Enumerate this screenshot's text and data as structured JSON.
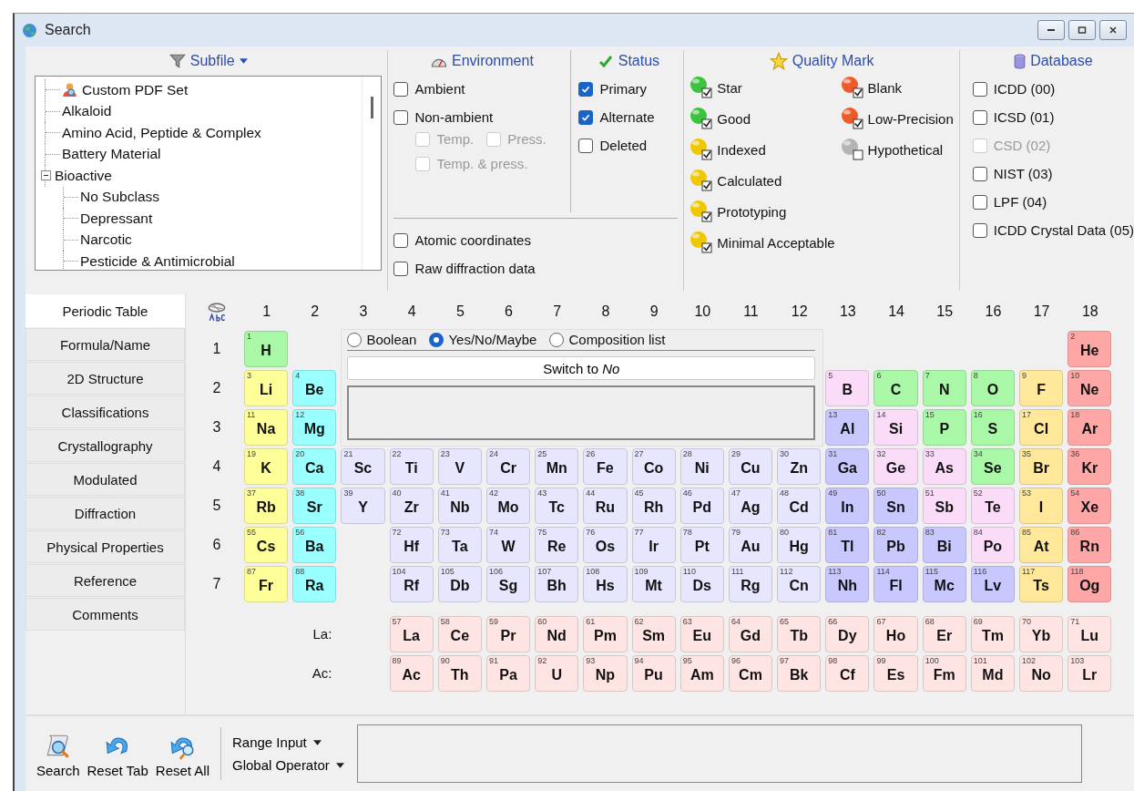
{
  "window": {
    "title": "Search"
  },
  "subfile": {
    "label": "Subfile",
    "tree": [
      {
        "label": "Custom PDF Set",
        "kind": "set"
      },
      {
        "label": "Alkaloid",
        "kind": "class"
      },
      {
        "label": "Amino Acid, Peptide & Complex",
        "kind": "class"
      },
      {
        "label": "Battery Material",
        "kind": "class"
      },
      {
        "label": "Bioactive",
        "kind": "class",
        "expanded": true,
        "children": [
          {
            "label": "No Subclass"
          },
          {
            "label": "Depressant"
          },
          {
            "label": "Narcotic"
          },
          {
            "label": "Pesticide & Antimicrobial"
          }
        ]
      }
    ]
  },
  "environment": {
    "label": "Environment",
    "options": [
      {
        "label": "Ambient",
        "checked": false,
        "disabled": false,
        "kind": "main"
      },
      {
        "label": "Non-ambient",
        "checked": false,
        "disabled": false,
        "kind": "main"
      },
      {
        "label": "Temp.",
        "checked": false,
        "disabled": true,
        "kind": "sub"
      },
      {
        "label": "Press.",
        "checked": false,
        "disabled": true,
        "kind": "sub"
      },
      {
        "label": "Temp. & press.",
        "checked": false,
        "disabled": true,
        "kind": "sub"
      }
    ],
    "extras": [
      {
        "label": "Atomic coordinates",
        "checked": false
      },
      {
        "label": "Raw diffraction data",
        "checked": false
      }
    ]
  },
  "status": {
    "label": "Status",
    "options": [
      {
        "label": "Primary",
        "checked": true
      },
      {
        "label": "Alternate",
        "checked": true
      },
      {
        "label": "Deleted",
        "checked": false
      }
    ]
  },
  "quality_mark": {
    "label": "Quality Mark",
    "columns": [
      [
        {
          "label": "Star",
          "color": "#3cc23c",
          "checked": true
        },
        {
          "label": "Good",
          "color": "#3cc23c",
          "checked": true
        },
        {
          "label": "Indexed",
          "color": "#f0c800",
          "checked": true
        },
        {
          "label": "Calculated",
          "color": "#f0c800",
          "checked": true
        },
        {
          "label": "Prototyping",
          "color": "#f0c800",
          "checked": true
        },
        {
          "label": "Minimal Acceptable",
          "color": "#f0c800",
          "checked": true
        }
      ],
      [
        {
          "label": "Blank",
          "color": "#f05a28",
          "checked": true
        },
        {
          "label": "Low-Precision",
          "color": "#f05a28",
          "checked": true
        },
        {
          "label": "Hypothetical",
          "color": "#b4b4b4",
          "checked": false
        }
      ]
    ]
  },
  "database": {
    "label": "Database",
    "options": [
      {
        "label": "ICDD (00)",
        "checked": false,
        "disabled": false
      },
      {
        "label": "ICSD (01)",
        "checked": false,
        "disabled": false
      },
      {
        "label": "CSD (02)",
        "checked": false,
        "disabled": true
      },
      {
        "label": "NIST (03)",
        "checked": false,
        "disabled": false
      },
      {
        "label": "LPF (04)",
        "checked": false,
        "disabled": false
      },
      {
        "label": "ICDD Crystal Data (05)",
        "checked": false,
        "disabled": false
      }
    ]
  },
  "tabs": [
    {
      "label": "Periodic Table",
      "selected": true
    },
    {
      "label": "Formula/Name",
      "selected": false
    },
    {
      "label": "2D Structure",
      "selected": false
    },
    {
      "label": "Classifications",
      "selected": false
    },
    {
      "label": "Crystallography",
      "selected": false
    },
    {
      "label": "Modulated",
      "selected": false
    },
    {
      "label": "Diffraction",
      "selected": false
    },
    {
      "label": "Physical Properties",
      "selected": false
    },
    {
      "label": "Reference",
      "selected": false
    },
    {
      "label": "Comments",
      "selected": false
    }
  ],
  "periodic_table": {
    "groups": [
      "1",
      "2",
      "3",
      "4",
      "5",
      "6",
      "7",
      "8",
      "9",
      "10",
      "11",
      "12",
      "13",
      "14",
      "15",
      "16",
      "17",
      "18"
    ],
    "mode_panel": {
      "modes": [
        {
          "label": "Boolean",
          "selected": false
        },
        {
          "label": "Yes/No/Maybe",
          "selected": true
        },
        {
          "label": "Composition list",
          "selected": false
        }
      ],
      "switch_button": "Switch to *No*"
    },
    "rows": [
      {
        "label": "1",
        "cells": [
          {
            "kind": "element",
            "number": "1",
            "symbol": "H",
            "color": "#a8f8a8"
          },
          {
            "kind": "blank"
          },
          {
            "kind": "blank"
          },
          {
            "kind": "blank"
          },
          {
            "kind": "blank"
          },
          {
            "kind": "blank"
          },
          {
            "kind": "blank"
          },
          {
            "kind": "blank"
          },
          {
            "kind": "blank"
          },
          {
            "kind": "blank"
          },
          {
            "kind": "blank"
          },
          {
            "kind": "blank"
          },
          {
            "kind": "blank"
          },
          {
            "kind": "blank"
          },
          {
            "kind": "blank"
          },
          {
            "kind": "blank"
          },
          {
            "kind": "blank"
          },
          {
            "kind": "element",
            "number": "2",
            "symbol": "He",
            "color": "#ffa6a6"
          }
        ]
      },
      {
        "label": "2",
        "cells": [
          {
            "kind": "element",
            "number": "3",
            "symbol": "Li",
            "color": "#ffff99"
          },
          {
            "kind": "element",
            "number": "4",
            "symbol": "Be",
            "color": "#99ffff"
          },
          {
            "kind": "blank"
          },
          {
            "kind": "blank"
          },
          {
            "kind": "blank"
          },
          {
            "kind": "blank"
          },
          {
            "kind": "blank"
          },
          {
            "kind": "blank"
          },
          {
            "kind": "blank"
          },
          {
            "kind": "blank"
          },
          {
            "kind": "blank"
          },
          {
            "kind": "blank"
          },
          {
            "kind": "element",
            "number": "5",
            "symbol": "B",
            "color": "#fadcf8"
          },
          {
            "kind": "element",
            "number": "6",
            "symbol": "C",
            "color": "#a8f8a8"
          },
          {
            "kind": "element",
            "number": "7",
            "symbol": "N",
            "color": "#a8f8a8"
          },
          {
            "kind": "element",
            "number": "8",
            "symbol": "O",
            "color": "#a8f8a8"
          },
          {
            "kind": "element",
            "number": "9",
            "symbol": "F",
            "color": "#ffe89a"
          },
          {
            "kind": "element",
            "number": "10",
            "symbol": "Ne",
            "color": "#ffa6a6"
          }
        ]
      },
      {
        "label": "3",
        "cells": [
          {
            "kind": "element",
            "number": "11",
            "symbol": "Na",
            "color": "#ffff99"
          },
          {
            "kind": "element",
            "number": "12",
            "symbol": "Mg",
            "color": "#99ffff"
          },
          {
            "kind": "blank"
          },
          {
            "kind": "blank"
          },
          {
            "kind": "blank"
          },
          {
            "kind": "blank"
          },
          {
            "kind": "blank"
          },
          {
            "kind": "blank"
          },
          {
            "kind": "blank"
          },
          {
            "kind": "blank"
          },
          {
            "kind": "blank"
          },
          {
            "kind": "blank"
          },
          {
            "kind": "element",
            "number": "13",
            "symbol": "Al",
            "color": "#c8c8ff"
          },
          {
            "kind": "element",
            "number": "14",
            "symbol": "Si",
            "color": "#fadcf8"
          },
          {
            "kind": "element",
            "number": "15",
            "symbol": "P",
            "color": "#a8f8a8"
          },
          {
            "kind": "element",
            "number": "16",
            "symbol": "S",
            "color": "#a8f8a8"
          },
          {
            "kind": "element",
            "number": "17",
            "symbol": "Cl",
            "color": "#ffe89a"
          },
          {
            "kind": "element",
            "number": "18",
            "symbol": "Ar",
            "color": "#ffa6a6"
          }
        ]
      },
      {
        "label": "4",
        "cells": [
          {
            "kind": "element",
            "number": "19",
            "symbol": "K",
            "color": "#ffff99"
          },
          {
            "kind": "element",
            "number": "20",
            "symbol": "Ca",
            "color": "#99ffff"
          },
          {
            "kind": "element",
            "number": "21",
            "symbol": "Sc",
            "color": "#e6e6ff"
          },
          {
            "kind": "element",
            "number": "22",
            "symbol": "Ti",
            "color": "#e6e6ff"
          },
          {
            "kind": "element",
            "number": "23",
            "symbol": "V",
            "color": "#e6e6ff"
          },
          {
            "kind": "element",
            "number": "24",
            "symbol": "Cr",
            "color": "#e6e6ff"
          },
          {
            "kind": "element",
            "number": "25",
            "symbol": "Mn",
            "color": "#e6e6ff"
          },
          {
            "kind": "element",
            "number": "26",
            "symbol": "Fe",
            "color": "#e6e6ff"
          },
          {
            "kind": "element",
            "number": "27",
            "symbol": "Co",
            "color": "#e6e6ff"
          },
          {
            "kind": "element",
            "number": "28",
            "symbol": "Ni",
            "color": "#e6e6ff"
          },
          {
            "kind": "element",
            "number": "29",
            "symbol": "Cu",
            "color": "#e6e6ff"
          },
          {
            "kind": "element",
            "number": "30",
            "symbol": "Zn",
            "color": "#e6e6ff"
          },
          {
            "kind": "element",
            "number": "31",
            "symbol": "Ga",
            "color": "#c8c8ff"
          },
          {
            "kind": "element",
            "number": "32",
            "symbol": "Ge",
            "color": "#fadcf8"
          },
          {
            "kind": "element",
            "number": "33",
            "symbol": "As",
            "color": "#fadcf8"
          },
          {
            "kind": "element",
            "number": "34",
            "symbol": "Se",
            "color": "#a8f8a8"
          },
          {
            "kind": "element",
            "number": "35",
            "symbol": "Br",
            "color": "#ffe89a"
          },
          {
            "kind": "element",
            "number": "36",
            "symbol": "Kr",
            "color": "#ffa6a6"
          }
        ]
      },
      {
        "label": "5",
        "cells": [
          {
            "kind": "element",
            "number": "37",
            "symbol": "Rb",
            "color": "#ffff99"
          },
          {
            "kind": "element",
            "number": "38",
            "symbol": "Sr",
            "color": "#99ffff"
          },
          {
            "kind": "element",
            "number": "39",
            "symbol": "Y",
            "color": "#e6e6ff"
          },
          {
            "kind": "element",
            "number": "40",
            "symbol": "Zr",
            "color": "#e6e6ff"
          },
          {
            "kind": "element",
            "number": "41",
            "symbol": "Nb",
            "color": "#e6e6ff"
          },
          {
            "kind": "element",
            "number": "42",
            "symbol": "Mo",
            "color": "#e6e6ff"
          },
          {
            "kind": "element",
            "number": "43",
            "symbol": "Tc",
            "color": "#e6e6ff"
          },
          {
            "kind": "element",
            "number": "44",
            "symbol": "Ru",
            "color": "#e6e6ff"
          },
          {
            "kind": "element",
            "number": "45",
            "symbol": "Rh",
            "color": "#e6e6ff"
          },
          {
            "kind": "element",
            "number": "46",
            "symbol": "Pd",
            "color": "#e6e6ff"
          },
          {
            "kind": "element",
            "number": "47",
            "symbol": "Ag",
            "color": "#e6e6ff"
          },
          {
            "kind": "element",
            "number": "48",
            "symbol": "Cd",
            "color": "#e6e6ff"
          },
          {
            "kind": "element",
            "number": "49",
            "symbol": "In",
            "color": "#c8c8ff"
          },
          {
            "kind": "element",
            "number": "50",
            "symbol": "Sn",
            "color": "#c8c8ff"
          },
          {
            "kind": "element",
            "number": "51",
            "symbol": "Sb",
            "color": "#fadcf8"
          },
          {
            "kind": "element",
            "number": "52",
            "symbol": "Te",
            "color": "#fadcf8"
          },
          {
            "kind": "element",
            "number": "53",
            "symbol": "I",
            "color": "#ffe89a"
          },
          {
            "kind": "element",
            "number": "54",
            "symbol": "Xe",
            "color": "#ffa6a6"
          }
        ]
      },
      {
        "label": "6",
        "cells": [
          {
            "kind": "element",
            "number": "55",
            "symbol": "Cs",
            "color": "#ffff99"
          },
          {
            "kind": "element",
            "number": "56",
            "symbol": "Ba",
            "color": "#99ffff"
          },
          {
            "kind": "blank"
          },
          {
            "kind": "element",
            "number": "72",
            "symbol": "Hf",
            "color": "#e6e6ff"
          },
          {
            "kind": "element",
            "number": "73",
            "symbol": "Ta",
            "color": "#e6e6ff"
          },
          {
            "kind": "element",
            "number": "74",
            "symbol": "W",
            "color": "#e6e6ff"
          },
          {
            "kind": "element",
            "number": "75",
            "symbol": "Re",
            "color": "#e6e6ff"
          },
          {
            "kind": "element",
            "number": "76",
            "symbol": "Os",
            "color": "#e6e6ff"
          },
          {
            "kind": "element",
            "number": "77",
            "symbol": "Ir",
            "color": "#e6e6ff"
          },
          {
            "kind": "element",
            "number": "78",
            "symbol": "Pt",
            "color": "#e6e6ff"
          },
          {
            "kind": "element",
            "number": "79",
            "symbol": "Au",
            "color": "#e6e6ff"
          },
          {
            "kind": "element",
            "number": "80",
            "symbol": "Hg",
            "color": "#e6e6ff"
          },
          {
            "kind": "element",
            "number": "81",
            "symbol": "Tl",
            "color": "#c8c8ff"
          },
          {
            "kind": "element",
            "number": "82",
            "symbol": "Pb",
            "color": "#c8c8ff"
          },
          {
            "kind": "element",
            "number": "83",
            "symbol": "Bi",
            "color": "#c8c8ff"
          },
          {
            "kind": "element",
            "number": "84",
            "symbol": "Po",
            "color": "#fadcf8"
          },
          {
            "kind": "element",
            "number": "85",
            "symbol": "At",
            "color": "#ffe89a"
          },
          {
            "kind": "element",
            "number": "86",
            "symbol": "Rn",
            "color": "#ffa6a6"
          }
        ]
      },
      {
        "label": "7",
        "cells": [
          {
            "kind": "element",
            "number": "87",
            "symbol": "Fr",
            "color": "#ffff99"
          },
          {
            "kind": "element",
            "number": "88",
            "symbol": "Ra",
            "color": "#99ffff"
          },
          {
            "kind": "blank"
          },
          {
            "kind": "element",
            "number": "104",
            "symbol": "Rf",
            "color": "#e6e6ff"
          },
          {
            "kind": "element",
            "number": "105",
            "symbol": "Db",
            "color": "#e6e6ff"
          },
          {
            "kind": "element",
            "number": "106",
            "symbol": "Sg",
            "color": "#e6e6ff"
          },
          {
            "kind": "element",
            "number": "107",
            "symbol": "Bh",
            "color": "#e6e6ff"
          },
          {
            "kind": "element",
            "number": "108",
            "symbol": "Hs",
            "color": "#e6e6ff"
          },
          {
            "kind": "element",
            "number": "109",
            "symbol": "Mt",
            "color": "#e6e6ff"
          },
          {
            "kind": "element",
            "number": "110",
            "symbol": "Ds",
            "color": "#e6e6ff"
          },
          {
            "kind": "element",
            "number": "111",
            "symbol": "Rg",
            "color": "#e6e6ff"
          },
          {
            "kind": "element",
            "number": "112",
            "symbol": "Cn",
            "color": "#e6e6ff"
          },
          {
            "kind": "element",
            "number": "113",
            "symbol": "Nh",
            "color": "#c8c8ff"
          },
          {
            "kind": "element",
            "number": "114",
            "symbol": "Fl",
            "color": "#c8c8ff"
          },
          {
            "kind": "element",
            "number": "115",
            "symbol": "Mc",
            "color": "#c8c8ff"
          },
          {
            "kind": "element",
            "number": "116",
            "symbol": "Lv",
            "color": "#c8c8ff"
          },
          {
            "kind": "element",
            "number": "117",
            "symbol": "Ts",
            "color": "#ffe89a"
          },
          {
            "kind": "element",
            "number": "118",
            "symbol": "Og",
            "color": "#ffa6a6"
          }
        ]
      }
    ],
    "series": [
      {
        "label": "La:",
        "cells": [
          {
            "kind": "blank"
          },
          {
            "kind": "blank"
          },
          {
            "kind": "blank"
          },
          {
            "kind": "element",
            "number": "57",
            "symbol": "La",
            "color": "#ffe4e4"
          },
          {
            "kind": "element",
            "number": "58",
            "symbol": "Ce",
            "color": "#ffe4e4"
          },
          {
            "kind": "element",
            "number": "59",
            "symbol": "Pr",
            "color": "#ffe4e4"
          },
          {
            "kind": "element",
            "number": "60",
            "symbol": "Nd",
            "color": "#ffe4e4"
          },
          {
            "kind": "element",
            "number": "61",
            "symbol": "Pm",
            "color": "#ffe4e4"
          },
          {
            "kind": "element",
            "number": "62",
            "symbol": "Sm",
            "color": "#ffe4e4"
          },
          {
            "kind": "element",
            "number": "63",
            "symbol": "Eu",
            "color": "#ffe4e4"
          },
          {
            "kind": "element",
            "number": "64",
            "symbol": "Gd",
            "color": "#ffe4e4"
          },
          {
            "kind": "element",
            "number": "65",
            "symbol": "Tb",
            "color": "#ffe4e4"
          },
          {
            "kind": "element",
            "number": "66",
            "symbol": "Dy",
            "color": "#ffe4e4"
          },
          {
            "kind": "element",
            "number": "67",
            "symbol": "Ho",
            "color": "#ffe4e4"
          },
          {
            "kind": "element",
            "number": "68",
            "symbol": "Er",
            "color": "#ffe4e4"
          },
          {
            "kind": "element",
            "number": "69",
            "symbol": "Tm",
            "color": "#ffe4e4"
          },
          {
            "kind": "element",
            "number": "70",
            "symbol": "Yb",
            "color": "#ffe4e4"
          },
          {
            "kind": "element",
            "number": "71",
            "symbol": "Lu",
            "color": "#ffe4e4"
          }
        ]
      },
      {
        "label": "Ac:",
        "cells": [
          {
            "kind": "blank"
          },
          {
            "kind": "blank"
          },
          {
            "kind": "blank"
          },
          {
            "kind": "element",
            "number": "89",
            "symbol": "Ac",
            "color": "#ffe4e4"
          },
          {
            "kind": "element",
            "number": "90",
            "symbol": "Th",
            "color": "#ffe4e4"
          },
          {
            "kind": "element",
            "number": "91",
            "symbol": "Pa",
            "color": "#ffe4e4"
          },
          {
            "kind": "element",
            "number": "92",
            "symbol": "U",
            "color": "#ffe4e4"
          },
          {
            "kind": "element",
            "number": "93",
            "symbol": "Np",
            "color": "#ffe4e4"
          },
          {
            "kind": "element",
            "number": "94",
            "symbol": "Pu",
            "color": "#ffe4e4"
          },
          {
            "kind": "element",
            "number": "95",
            "symbol": "Am",
            "color": "#ffe4e4"
          },
          {
            "kind": "element",
            "number": "96",
            "symbol": "Cm",
            "color": "#ffe4e4"
          },
          {
            "kind": "element",
            "number": "97",
            "symbol": "Bk",
            "color": "#ffe4e4"
          },
          {
            "kind": "element",
            "number": "98",
            "symbol": "Cf",
            "color": "#ffe4e4"
          },
          {
            "kind": "element",
            "number": "99",
            "symbol": "Es",
            "color": "#ffe4e4"
          },
          {
            "kind": "element",
            "number": "100",
            "symbol": "Fm",
            "color": "#ffe4e4"
          },
          {
            "kind": "element",
            "number": "101",
            "symbol": "Md",
            "color": "#ffe4e4"
          },
          {
            "kind": "element",
            "number": "102",
            "symbol": "No",
            "color": "#ffe4e4"
          },
          {
            "kind": "element",
            "number": "103",
            "symbol": "Lr",
            "color": "#ffe4e4"
          }
        ]
      }
    ]
  },
  "toolbar": {
    "buttons": [
      {
        "label": "Search",
        "kind": "search"
      },
      {
        "label": "Reset Tab",
        "kind": "reset_tab"
      },
      {
        "label": "Reset All",
        "kind": "reset_all"
      }
    ],
    "dropdowns": [
      "Range Input",
      "Global Operator"
    ]
  }
}
